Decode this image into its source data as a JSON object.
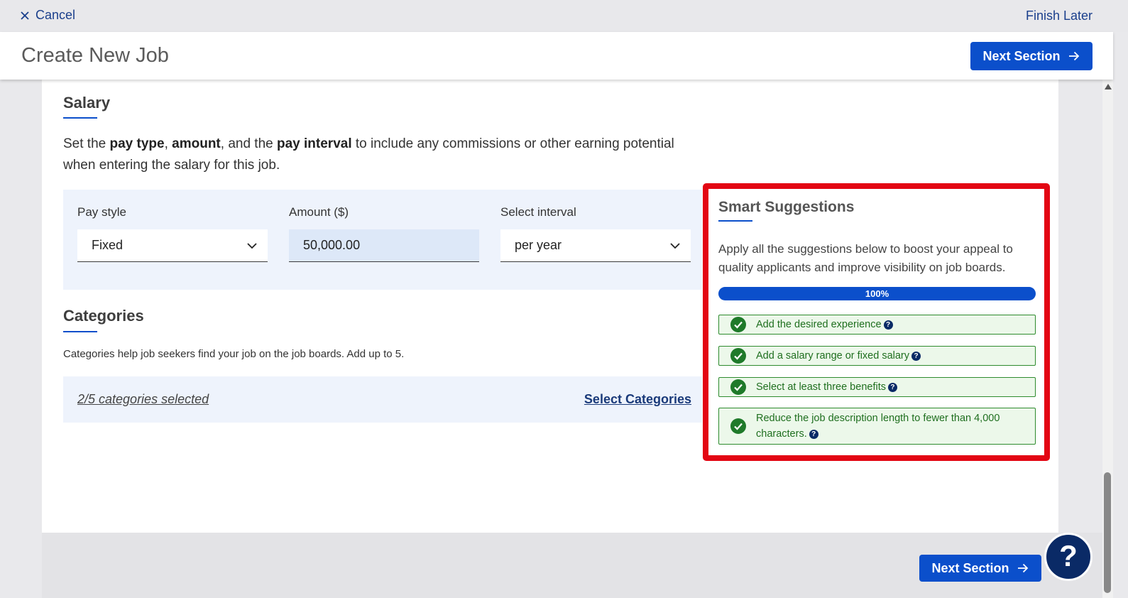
{
  "topbar": {
    "cancel_label": "Cancel",
    "finish_later_label": "Finish Later"
  },
  "header": {
    "title": "Create New Job",
    "next_section_label": "Next Section"
  },
  "salary": {
    "title": "Salary",
    "desc_parts": [
      "Set the ",
      "pay type",
      ", ",
      "amount",
      ", and the ",
      "pay interval",
      " to include any commissions or other earning potential when entering the salary for this job."
    ],
    "pay_style_label": "Pay style",
    "pay_style_value": "Fixed",
    "amount_label": "Amount ($)",
    "amount_value": "50,000.00",
    "interval_label": "Select interval",
    "interval_value": "per year"
  },
  "categories": {
    "title": "Categories",
    "desc": "Categories help job seekers find your job on the job boards. Add up to 5.",
    "count_text": "2/5 categories selected",
    "select_label": "Select Categories"
  },
  "smart_suggestions": {
    "title": "Smart Suggestions",
    "desc": "Apply all the suggestions below to boost your appeal to quality applicants and improve visibility on job boards.",
    "progress_text": "100%",
    "progress_value": 100,
    "items": [
      {
        "text": "Add the desired experience",
        "help": "?"
      },
      {
        "text": "Add a salary range or fixed salary",
        "help": "?"
      },
      {
        "text": "Select at least three benefits",
        "help": "?"
      },
      {
        "text": "Reduce the job description length to fewer than 4,000 characters.",
        "help": "?"
      }
    ]
  },
  "footer": {
    "next_section_label": "Next Section"
  },
  "help_button": {
    "label": "?"
  },
  "colors": {
    "primary": "#0b4fcb",
    "highlight_border": "#e30613",
    "success": "#2e8b2e",
    "help_bg": "#0a2a66"
  }
}
